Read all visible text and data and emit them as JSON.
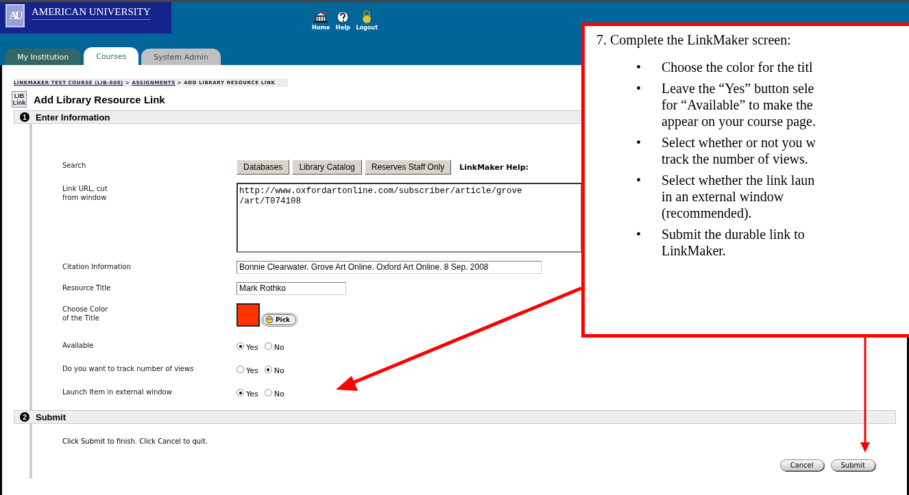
{
  "header": {
    "logo_mark": "AU",
    "logo_text": "AMERICAN UNIVERSITY",
    "nav": [
      {
        "kind": "home",
        "label": "Home"
      },
      {
        "kind": "help",
        "label": "Help"
      },
      {
        "kind": "logout",
        "label": "Logout"
      }
    ]
  },
  "tabs": [
    {
      "label": "My Institution",
      "selected": false,
      "color": "#336666"
    },
    {
      "label": "Courses",
      "selected": true,
      "color": "#ffffff"
    },
    {
      "label": "System Admin",
      "selected": false,
      "color": "#c0c0c0"
    }
  ],
  "breadcrumb": [
    {
      "kind": "link",
      "text": "LINKMAKER TEST COURSE (LIB-600)"
    },
    {
      "kind": "separator",
      "text": ">"
    },
    {
      "kind": "link",
      "text": "ASSIGNMENTS"
    },
    {
      "kind": "separator",
      "text": ">"
    },
    {
      "kind": "current",
      "text": "ADD LIBRARY RESOURCE LINK"
    }
  ],
  "page": {
    "icon_text": [
      "LIB",
      "Link"
    ],
    "title": "Add Library Resource Link"
  },
  "info_section": {
    "number": "1",
    "title": "Enter Information",
    "rows": [
      {
        "kind": "buttons",
        "label_lines": [
          "Search"
        ],
        "buttons": [
          "Databases",
          "Library Catalog",
          "Reserves Staff Only"
        ],
        "help_label": "LinkMaker Help:"
      },
      {
        "kind": "textarea",
        "label_lines": [
          "Link URL, cut",
          "from window"
        ],
        "value_lines": [
          "http://www.oxfordartonline.com/subscriber/article/grove",
          "/art/T074108"
        ]
      },
      {
        "kind": "text",
        "label_lines": [
          "Citation Information"
        ],
        "value": "Bonnie Clearwater. Grove Art Online. Oxford Art Online. 8 Sep. 2008"
      },
      {
        "kind": "text",
        "label_lines": [
          "Resource Title"
        ],
        "value": "Mark Rothko"
      },
      {
        "kind": "color",
        "label_lines": [
          "Choose Color",
          "of the Title"
        ],
        "color": "#ff3300",
        "button": "Pick"
      },
      {
        "kind": "radio",
        "label_lines": [
          "Available"
        ],
        "options": [
          {
            "label": "Yes",
            "selected": true
          },
          {
            "label": "No",
            "selected": false
          }
        ]
      },
      {
        "kind": "radio",
        "label_lines": [
          "Do you want to track number of views"
        ],
        "options": [
          {
            "label": "Yes",
            "selected": false
          },
          {
            "label": "No",
            "selected": true
          }
        ]
      },
      {
        "kind": "radio",
        "label_lines": [
          "Launch Item in external window"
        ],
        "options": [
          {
            "label": "Yes",
            "selected": true
          },
          {
            "label": "No",
            "selected": false
          }
        ]
      }
    ]
  },
  "submit_section": {
    "number": "2",
    "title": "Submit",
    "instructions": "Click Submit to finish. Click Cancel to quit.",
    "buttons": [
      "Cancel",
      "Submit"
    ]
  },
  "callout": {
    "title": "7. Complete the LinkMaker screen:",
    "bullets": [
      {
        "marker": "•",
        "lines": [
          "Choose the color for the titl"
        ]
      },
      {
        "marker": "•",
        "lines": [
          "Leave the “Yes” button sele",
          "for “Available” to make the",
          "appear on your course page."
        ]
      },
      {
        "marker": "•",
        "lines": [
          "Select whether or not you w",
          "track the number of views."
        ]
      },
      {
        "marker": "•",
        "lines": [
          "Select whether the link laun",
          "in an external window",
          "(recommended)."
        ]
      },
      {
        "marker": "•",
        "lines": [
          "Submit the durable link to",
          "LinkMaker."
        ]
      }
    ]
  }
}
